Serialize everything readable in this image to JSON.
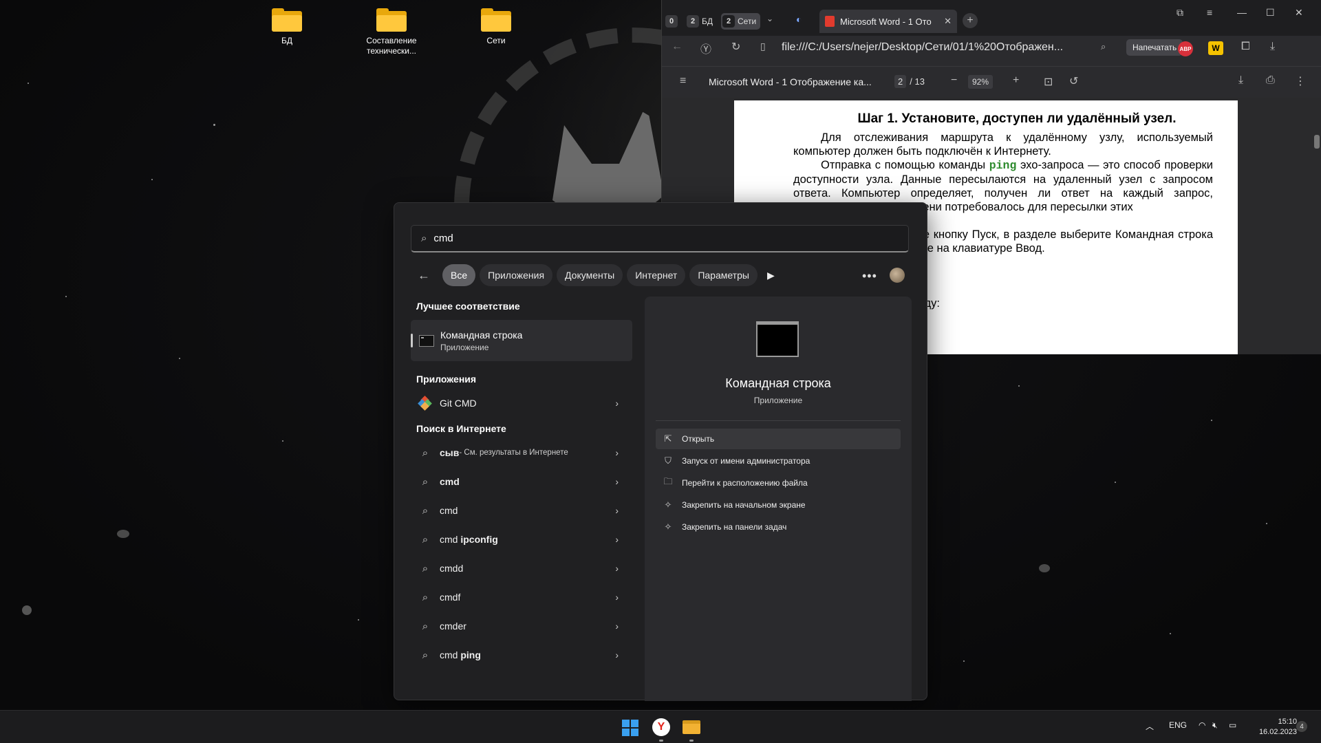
{
  "desktop": {
    "icons": [
      {
        "label": "БД"
      },
      {
        "label": "Составление технически..."
      },
      {
        "label": "Сети"
      }
    ]
  },
  "browser": {
    "tab_groups": [
      {
        "count": "0",
        "name": ""
      },
      {
        "count": "2",
        "name": "БД"
      },
      {
        "count": "2",
        "name": "Сети"
      }
    ],
    "active_tab_title": "Microsoft Word - 1 Ото",
    "address": "file:///C:/Users/nejer/Desktop/Сети/01/1%20Отображен...",
    "print_label": "Напечатать",
    "ext_abp": "ABP",
    "ext_w": "W",
    "pdf": {
      "title": "Microsoft Word - 1 Отображение ка...",
      "page_current": "2",
      "page_total": "/ 13",
      "zoom": "92%",
      "heading": "Шаг 1. Установите, доступен ли удалённый узел.",
      "para1": "Для отслеживания маршрута к удалённому узлу, используемый компьютер должен быть подключён к Интернету.",
      "para2_before": "Отправка с помощью команды ",
      "para2_code": "ping",
      "para2_after": " эхо-запроса — это способ проверки доступности узла. Данные пересылаются на удаленный узел с запросом ответа. Компьютер определяет, получен ли ответ на каждый запрос, вычисляет сколько времени потребовалось для пересылки этих",
      "para3": "оле компьютера нажмите кнопку Пуск, в разделе выберите Командная строка или в поле Поиск нажмите на клавиатуре Ввод.",
      "para4": "ой строки введите команду:"
    }
  },
  "search": {
    "query": "cmd",
    "filters": [
      "Все",
      "Приложения",
      "Документы",
      "Интернет",
      "Параметры"
    ],
    "best_match_title": "Лучшее соответствие",
    "best_match": {
      "name": "Командная строка",
      "type": "Приложение"
    },
    "apps_title": "Приложения",
    "apps": [
      {
        "name": "Git CMD"
      }
    ],
    "web_title": "Поиск в Интернете",
    "web_first": {
      "bold": "сыв",
      "rest": " - См. результаты в Интернете"
    },
    "web_results": [
      {
        "plain": "",
        "bold": "cmd"
      },
      {
        "plain": "cmd",
        "bold": ""
      },
      {
        "plain": "cmd ",
        "bold": "ipconfig"
      },
      {
        "plain": "cmdd",
        "bold": ""
      },
      {
        "plain": "cmdf",
        "bold": ""
      },
      {
        "plain": "cmder",
        "bold": ""
      },
      {
        "plain": "cmd ",
        "bold": "ping"
      }
    ],
    "detail": {
      "name": "Командная строка",
      "type": "Приложение",
      "actions": [
        {
          "label": "Открыть",
          "icon": "open-icon"
        },
        {
          "label": "Запуск от имени администратора",
          "icon": "admin-shield-icon"
        },
        {
          "label": "Перейти к расположению файла",
          "icon": "folder-icon"
        },
        {
          "label": "Закрепить на начальном экране",
          "icon": "pin-icon"
        },
        {
          "label": "Закрепить на панели задач",
          "icon": "pin-icon"
        }
      ]
    }
  },
  "taskbar": {
    "lang": "ENG",
    "time": "15:10",
    "date": "16.02.2023",
    "notifications": "4"
  },
  "colors": {
    "accent_blue": "#3aa0f0",
    "folder_yellow": "#ffc83d",
    "ping_green": "#2e8b2e"
  }
}
